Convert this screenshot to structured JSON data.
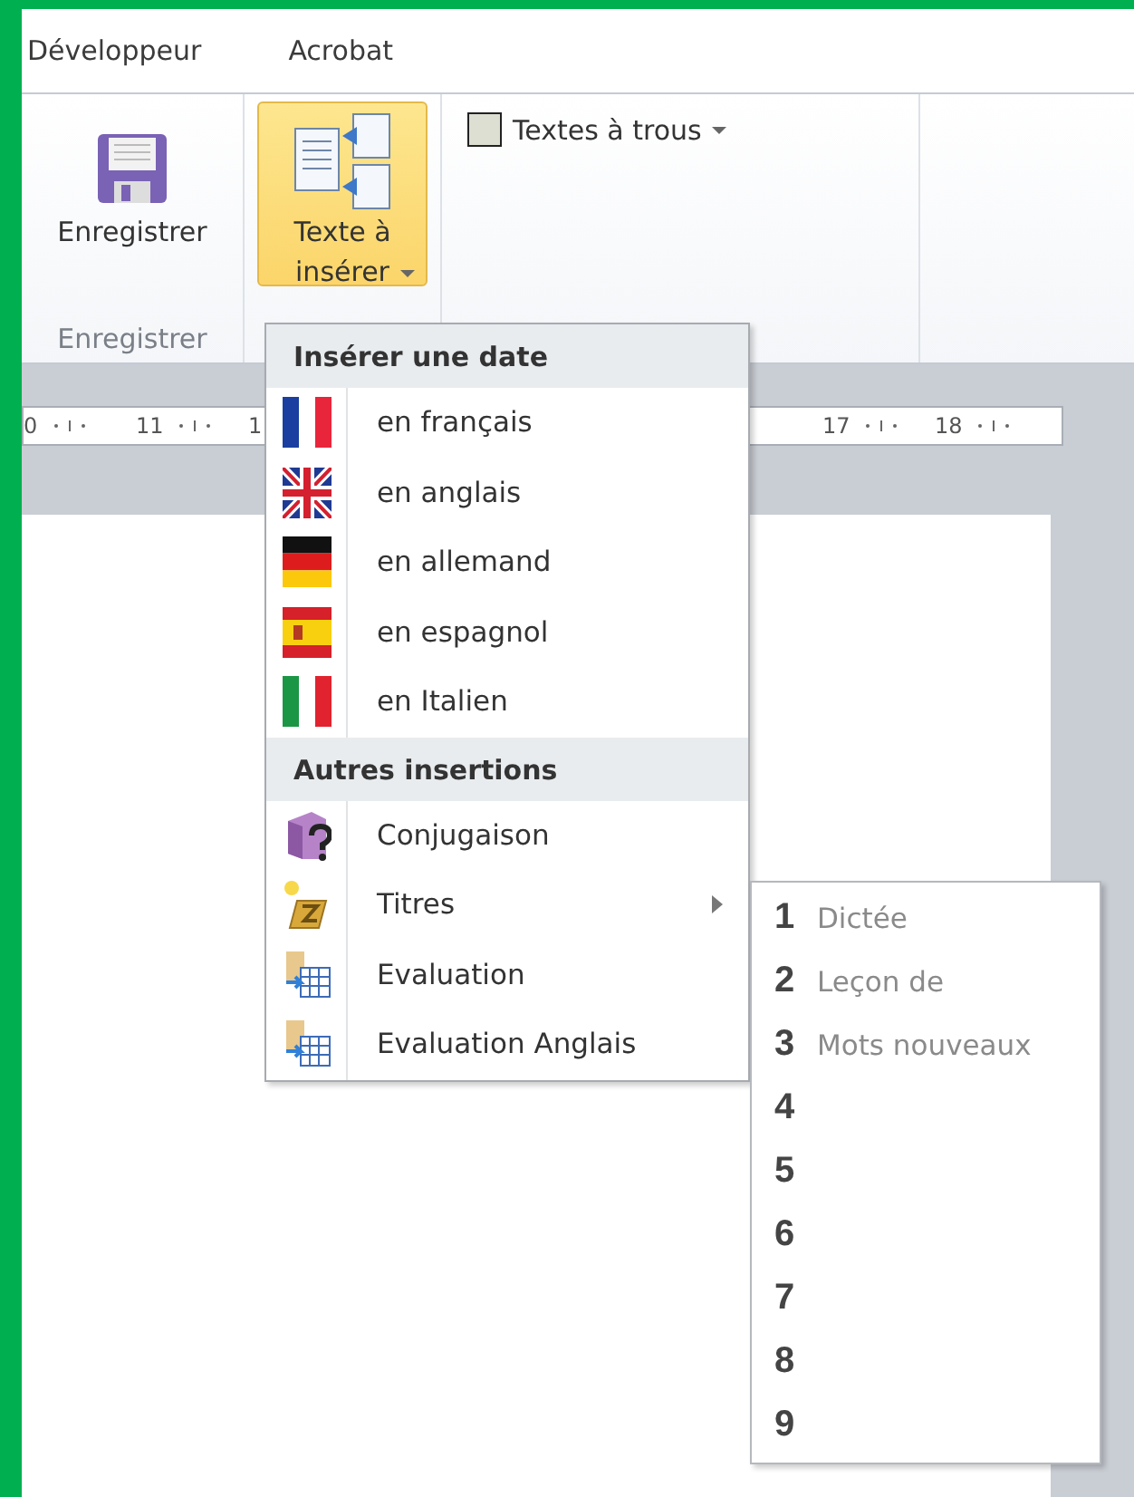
{
  "tabs": [
    {
      "label": "Développeur"
    },
    {
      "label": "Acrobat"
    }
  ],
  "ribbon": {
    "save_button": {
      "label": "Enregistrer"
    },
    "save_group_label": "Enregistrer",
    "insert_button": {
      "label": "Texte à insérer",
      "pressed": true
    },
    "gaps_dropdown": {
      "label": "Textes à trous"
    }
  },
  "ruler": {
    "left_labels": [
      "0",
      "11",
      "1"
    ],
    "right_labels": [
      "17",
      "18"
    ]
  },
  "menu": {
    "sections": [
      {
        "header": "Insérer une date",
        "items": [
          {
            "label": "en français",
            "kind": "fr"
          },
          {
            "label": "en anglais",
            "kind": "uk"
          },
          {
            "label": "en allemand",
            "kind": "de"
          },
          {
            "label": "en espagnol",
            "kind": "es"
          },
          {
            "label": "en Italien",
            "kind": "it"
          }
        ]
      },
      {
        "header": "Autres insertions",
        "items": [
          {
            "label": "Conjugaison",
            "kind": "book"
          },
          {
            "label": "Titres",
            "kind": "scroll",
            "submenu": true
          },
          {
            "label": "Evaluation",
            "kind": "table"
          },
          {
            "label": "Evaluation Anglais",
            "kind": "table"
          }
        ]
      }
    ]
  },
  "submenu": {
    "items": [
      {
        "number": "1",
        "label": "Dictée"
      },
      {
        "number": "2",
        "label": "Leçon de"
      },
      {
        "number": "3",
        "label": "Mots nouveaux"
      },
      {
        "number": "4"
      },
      {
        "number": "5"
      },
      {
        "number": "6"
      },
      {
        "number": "7"
      },
      {
        "number": "8"
      },
      {
        "number": "9"
      }
    ]
  }
}
